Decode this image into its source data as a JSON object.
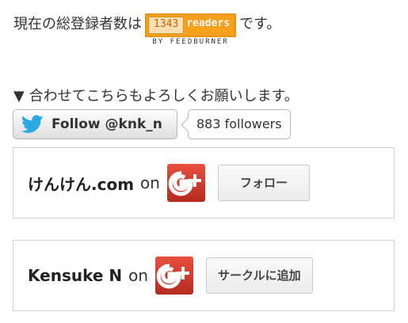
{
  "subscriber": {
    "prefix": "現在の総登録者数は",
    "count": "1343",
    "unit": "readers",
    "by": "BY FEEDBURNER",
    "suffix": "です。"
  },
  "also_line": "▼ 合わせてこちらもよろしくお願いします。",
  "twitter": {
    "button_label": "Follow @knk_n",
    "followers": "883 followers",
    "icon": "twitter-bird-icon"
  },
  "gplus": [
    {
      "name": "けんけん.com",
      "on": "on",
      "button": "フォロー",
      "icon": "google-plus-icon"
    },
    {
      "name": "Kensuke N",
      "on": "on",
      "button": "サークルに追加",
      "icon": "google-plus-icon"
    }
  ],
  "colors": {
    "feedburner_orange": "#f7a11c",
    "twitter_blue": "#2aa9e0",
    "gplus_red": "#d73d32"
  }
}
